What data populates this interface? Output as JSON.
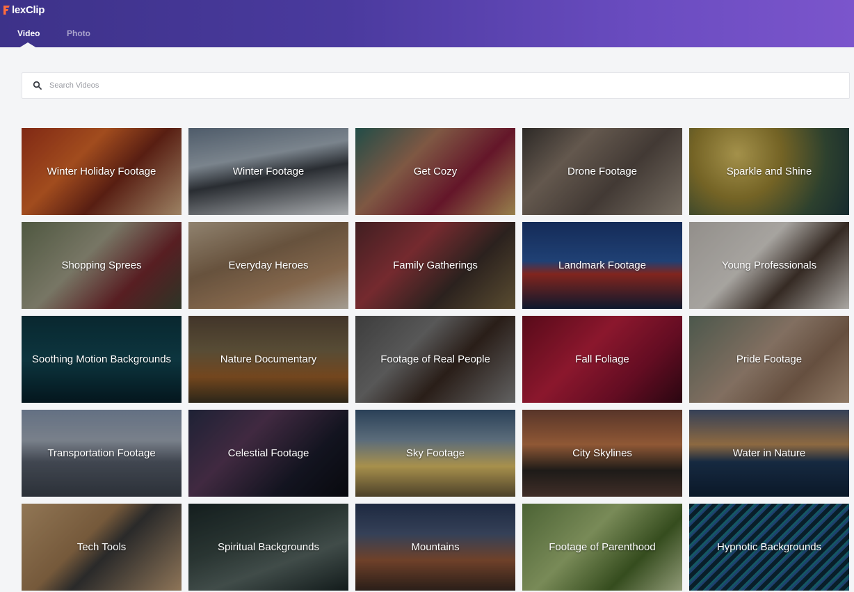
{
  "header": {
    "logo_text": "lexClip",
    "logo_letter": "F",
    "colors": {
      "gradient_start": "#3d3289",
      "gradient_end": "#7b55cc"
    },
    "tabs": [
      {
        "label": "Video",
        "active": true
      },
      {
        "label": "Photo",
        "active": false
      }
    ]
  },
  "search": {
    "placeholder": "Search Videos",
    "value": "",
    "icon": "search-icon"
  },
  "categories": [
    {
      "label": "Winter Holiday Footage",
      "bg": "linear-gradient(135deg,#b2391d 0%,#e06a2a 35%,#7a2a1a 60%,#d9b48a 100%)"
    },
    {
      "label": "Winter Footage",
      "bg": "linear-gradient(170deg,#6d7f93 0%,#aab7c3 35%,#3a3f46 55%,#e9edf1 100%)"
    },
    {
      "label": "Get Cozy",
      "bg": "linear-gradient(135deg,#2f6b64 0%,#b07a5e 35%,#8b1f3a 65%,#d2b26a 100%)"
    },
    {
      "label": "Drone Footage",
      "bg": "linear-gradient(135deg,#3f3a36 0%,#8a7a6c 30%,#5c5049 60%,#a39788 100%)"
    },
    {
      "label": "Sparkle and Shine",
      "bg": "radial-gradient(circle at 30% 30%,#e3c968 0%,#a18a34 35%,#3f5a40 70%,#1f3b40 100%)"
    },
    {
      "label": "Shopping Sprees",
      "bg": "linear-gradient(135deg,#6e7a5a 0%,#a6a48c 40%,#7a2a30 70%,#3f4a36 100%)"
    },
    {
      "label": "Everyday Heroes",
      "bg": "linear-gradient(160deg,#c8b59a 0%,#8f7255 40%,#b78f6a 70%,#e2d8c9 100%)"
    },
    {
      "label": "Family Gatherings",
      "bg": "linear-gradient(135deg,#5a2b2f 0%,#a23b42 35%,#3c2f2a 65%,#7d6a44 100%)"
    },
    {
      "label": "Landmark Footage",
      "bg": "linear-gradient(180deg,#1d3c7a 0%,#2c5aa2 45%,#b3342a 60%,#14223e 100%)"
    },
    {
      "label": "Young Professionals",
      "bg": "linear-gradient(135deg,#cbc6c0 0%,#e7e3dd 40%,#4a3b32 65%,#ece8e2 100%)"
    },
    {
      "label": "Soothing Motion Backgrounds",
      "bg": "linear-gradient(180deg,#0d3742 0%,#124a57 50%,#061f29 100%)"
    },
    {
      "label": "Nature Documentary",
      "bg": "linear-gradient(180deg,#5c4a3a 0%,#7a6a4a 40%,#a0622a 70%,#3d3522 100%)"
    },
    {
      "label": "Footage of Real People",
      "bg": "linear-gradient(135deg,#555555 0%,#7a7a7a 35%,#3a2a22 60%,#888888 100%)"
    },
    {
      "label": "Fall Foliage",
      "bg": "linear-gradient(135deg,#7a0f24 0%,#c1213f 40%,#8a1230 70%,#3a0a18 100%)"
    },
    {
      "label": "Pride Footage",
      "bg": "linear-gradient(135deg,#6a7a6a 0%,#b49a86 45%,#8d6e58 70%,#c7a98d 100%)"
    },
    {
      "label": "Transportation Footage",
      "bg": "linear-gradient(180deg,#8a9cb6 0%,#a8b2c0 35%,#5a6270 60%,#3d444e 100%)"
    },
    {
      "label": "Celestial Footage",
      "bg": "linear-gradient(135deg,#2a2f4a 0%,#5a3a5a 35%,#1a1c2c 70%,#0c0d14 100%)"
    },
    {
      "label": "Sky Footage",
      "bg": "linear-gradient(180deg,#3b5a7a 0%,#7f96aa 35%,#e8c86a 65%,#6a5a3a 100%)"
    },
    {
      "label": "City Skylines",
      "bg": "linear-gradient(180deg,#7a4a3a 0%,#c77a4a 40%,#2a2622 70%,#5a4038 100%)"
    },
    {
      "label": "Water in Nature",
      "bg": "linear-gradient(180deg,#4a5a7a 0%,#c4925a 40%,#1f3a5a 60%,#0f2238 100%)"
    },
    {
      "label": "Tech Tools",
      "bg": "linear-gradient(135deg,#c9a476 0%,#a37c52 40%,#3a3a3a 55%,#c5a27a 100%)"
    },
    {
      "label": "Spiritual Backgrounds",
      "bg": "linear-gradient(160deg,#1c2a2a 0%,#3a4a46 40%,#5a6a66 65%,#1a2626 100%)"
    },
    {
      "label": "Mountains",
      "bg": "linear-gradient(180deg,#2a3a5a 0%,#4a5a7a 35%,#9a5a3a 65%,#3a2a22 100%)"
    },
    {
      "label": "Footage of Parenthood",
      "bg": "linear-gradient(135deg,#6a8a4a 0%,#a8c07a 40%,#4a6a2a 70%,#c9d6a6 100%)"
    },
    {
      "label": "Hypnotic Backgrounds",
      "bg": "repeating-linear-gradient(135deg,#0d2a3a 0px,#0d2a3a 6px,#1d7a8a 6px,#1d7a8a 9px,#2a5a9a 9px,#2a5a9a 12px)"
    }
  ]
}
